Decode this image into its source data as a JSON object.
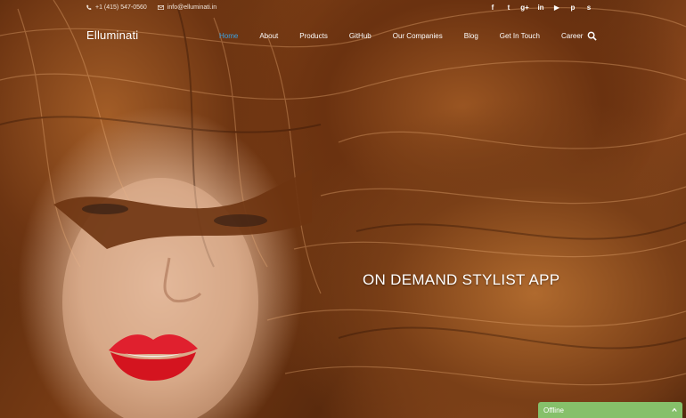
{
  "topbar": {
    "phone": "+1 (415) 547-0560",
    "email": "info@elluminati.in",
    "social_icons": [
      {
        "name": "facebook-icon",
        "glyph": "f"
      },
      {
        "name": "twitter-icon",
        "glyph": "t"
      },
      {
        "name": "google-plus-icon",
        "glyph": "g+"
      },
      {
        "name": "linkedin-icon",
        "glyph": "in"
      },
      {
        "name": "youtube-icon",
        "glyph": "▶"
      },
      {
        "name": "pinterest-icon",
        "glyph": "p"
      },
      {
        "name": "skype-icon",
        "glyph": "s"
      }
    ]
  },
  "nav": {
    "brand": "Elluminati",
    "items": [
      {
        "label": "Home",
        "active": true
      },
      {
        "label": "About",
        "active": false
      },
      {
        "label": "Products",
        "active": false
      },
      {
        "label": "GitHub",
        "active": false
      },
      {
        "label": "Our Companies",
        "active": false
      },
      {
        "label": "Blog",
        "active": false
      },
      {
        "label": "Get In Touch",
        "active": false
      },
      {
        "label": "Career",
        "active": false
      }
    ],
    "search_icon": "search-icon"
  },
  "hero": {
    "title": "ON DEMAND STYLIST APP"
  },
  "chat": {
    "status": "Offline"
  },
  "colors": {
    "active_link": "#3aa3e3",
    "chat_bg": "#86c06a",
    "lips": "#e0202e"
  }
}
